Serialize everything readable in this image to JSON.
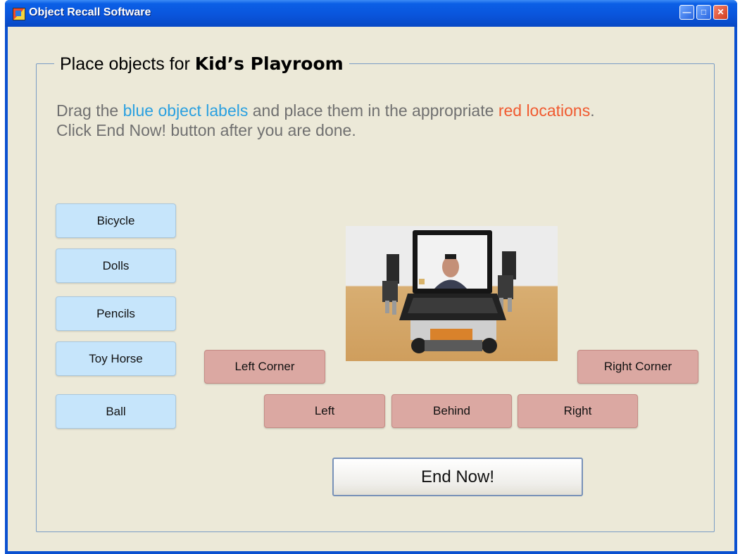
{
  "window": {
    "title": "Object Recall Software",
    "icon": "app-icon",
    "controls": [
      "minimize-icon",
      "maximize-icon",
      "close-icon"
    ]
  },
  "group": {
    "legend_prefix": "Place objects for ",
    "legend_room": "Kid’s Playroom"
  },
  "instructions": {
    "part1": "Drag the ",
    "blue_text": "blue object labels",
    "part2": " and place them in the appropriate ",
    "red_text": "red locations",
    "part3": ".",
    "line2": "Click End Now! button after you are done."
  },
  "object_labels": [
    "Bicycle",
    "Dolls",
    "Pencils",
    "Toy Horse",
    "Ball"
  ],
  "locations": {
    "left_corner": "Left Corner",
    "right_corner": "Right Corner",
    "left": "Left",
    "behind": "Behind",
    "right": "Right"
  },
  "end_button": "End Now!",
  "colors": {
    "object_label_bg": "#c6e5fb",
    "location_bg": "#dba8a2",
    "instruction_blue": "#2aa0e0",
    "instruction_red": "#f05a30"
  }
}
